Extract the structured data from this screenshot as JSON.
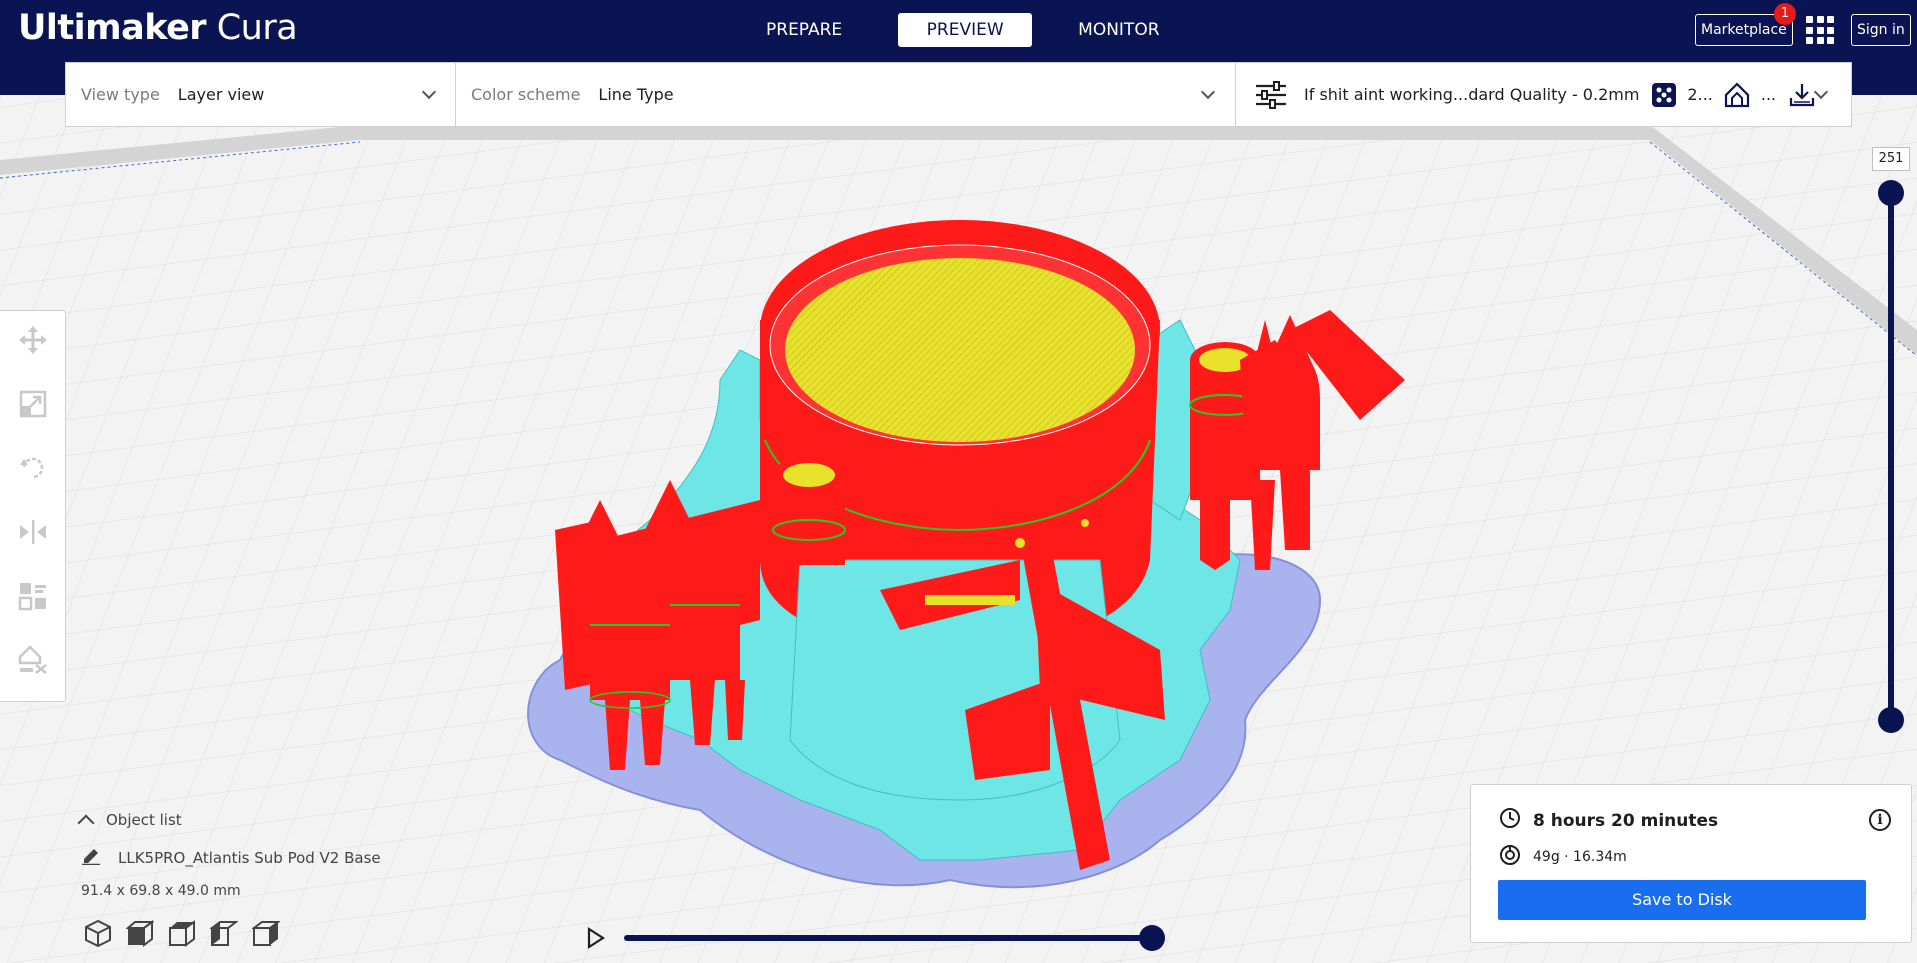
{
  "app": {
    "title_bold": "Ultimaker",
    "title_light": "Cura"
  },
  "stages": [
    "PREPARE",
    "PREVIEW",
    "MONITOR"
  ],
  "header": {
    "marketplace": "Marketplace",
    "marketplace_badge": "1",
    "signin": "Sign in"
  },
  "toolbar": {
    "view_type_label": "View type",
    "view_type_value": "Layer view",
    "color_scheme_label": "Color scheme",
    "color_scheme_value": "Line Type",
    "print_profile": "If shit aint working...dard Quality - 0.2mm",
    "infill": "2...",
    "support": "..."
  },
  "layer_slider": {
    "current_layer": "251",
    "max_layer": 251,
    "min_layer": 1
  },
  "objects": {
    "header": "Object list",
    "item": "LLK5PRO_Atlantis Sub Pod V2 Base",
    "dimensions": "91.4 x 69.8 x 49.0 mm"
  },
  "simulation": {
    "progress": 1.0
  },
  "print_info": {
    "time": "8 hours 20 minutes",
    "material": "49g · 16.34m",
    "save_label": "Save to Disk"
  },
  "colors": {
    "header_bg": "#0b1452",
    "accent": "#196ef0",
    "wall": "#ff1a1a",
    "infill": "#e8e22c",
    "support": "#6fe6e6",
    "skirt": "#a9b4ee",
    "skin": "#22cc22"
  },
  "icons": [
    "move-icon",
    "scale-icon",
    "rotate-icon",
    "mirror-icon",
    "per-model-settings-icon",
    "support-blocker-icon",
    "settings-sliders-icon",
    "infill-icon",
    "support-icon",
    "adhesion-icon",
    "clock-icon",
    "spool-icon",
    "info-icon",
    "play-icon",
    "pencil-icon",
    "view-3d-icon",
    "view-front-icon",
    "view-top-icon",
    "view-left-icon",
    "view-right-icon"
  ]
}
